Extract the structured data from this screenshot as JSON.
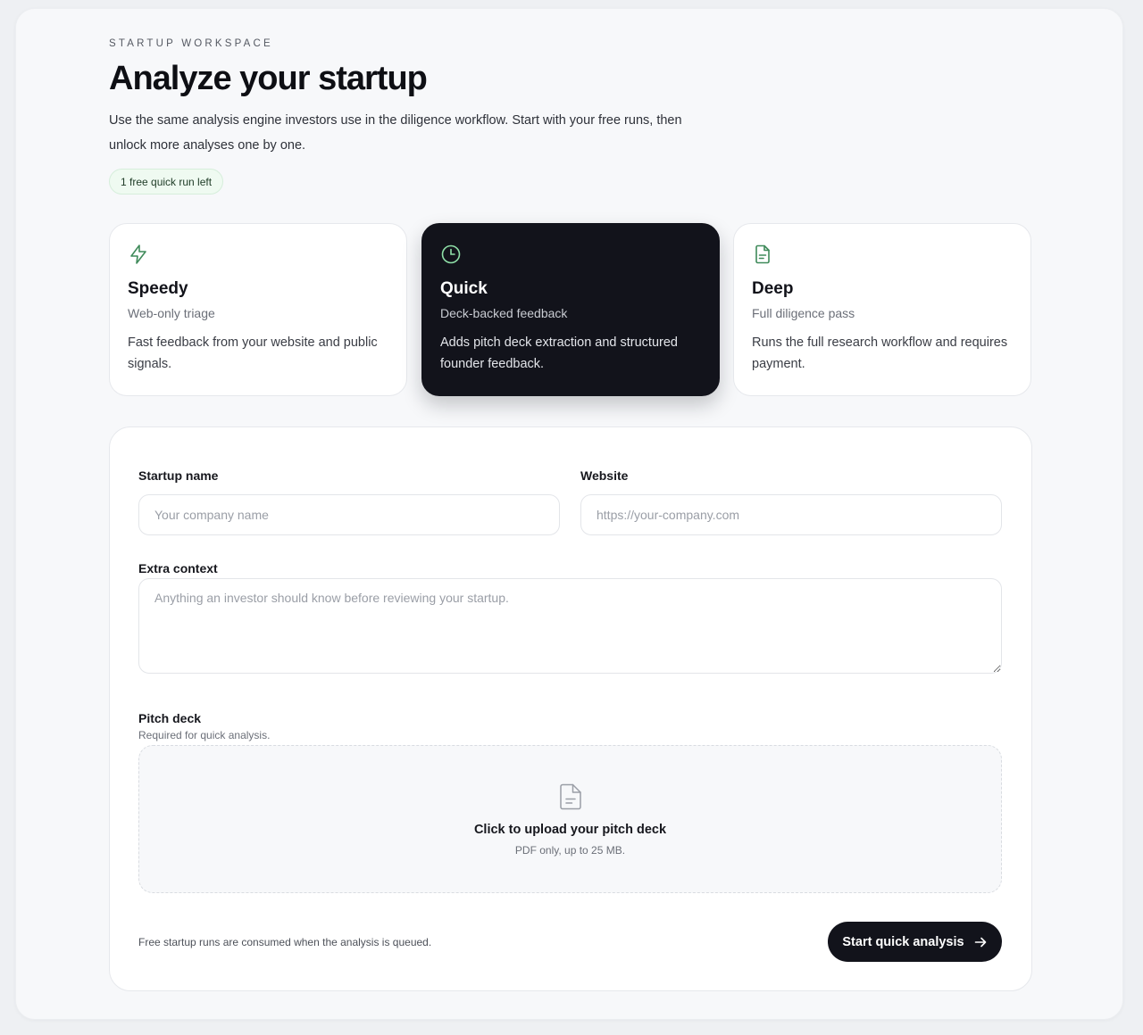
{
  "header": {
    "eyebrow": "STARTUP WORKSPACE",
    "title": "Analyze your startup",
    "subtitle": "Use the same analysis engine investors use in the diligence workflow. Start with your free runs, then unlock more analyses one by one.",
    "badge": "1 free quick run left"
  },
  "modes": [
    {
      "name": "Speedy",
      "tagline": "Web-only triage",
      "description": "Fast feedback from your website and public signals.",
      "icon": "lightning-icon",
      "selected": false
    },
    {
      "name": "Quick",
      "tagline": "Deck-backed feedback",
      "description": "Adds pitch deck extraction and structured founder feedback.",
      "icon": "clock-icon",
      "selected": true
    },
    {
      "name": "Deep",
      "tagline": "Full diligence pass",
      "description": "Runs the full research workflow and requires payment.",
      "icon": "document-icon",
      "selected": false
    }
  ],
  "form": {
    "startup_name": {
      "label": "Startup name",
      "placeholder": "Your company name",
      "value": ""
    },
    "website": {
      "label": "Website",
      "placeholder": "https://your-company.com",
      "value": ""
    },
    "extra_context": {
      "label": "Extra context",
      "placeholder": "Anything an investor should know before reviewing your startup.",
      "value": ""
    },
    "pitch_deck": {
      "label": "Pitch deck",
      "hint": "Required for quick analysis.",
      "upload_title": "Click to upload your pitch deck",
      "upload_hint": "PDF only, up to 25 MB."
    },
    "footer_note": "Free startup runs are consumed when the analysis is queued.",
    "submit_label": "Start quick analysis"
  },
  "colors": {
    "accent_green": "#3f8a5a",
    "dark": "#12131b",
    "badge_bg": "#effaf1"
  }
}
